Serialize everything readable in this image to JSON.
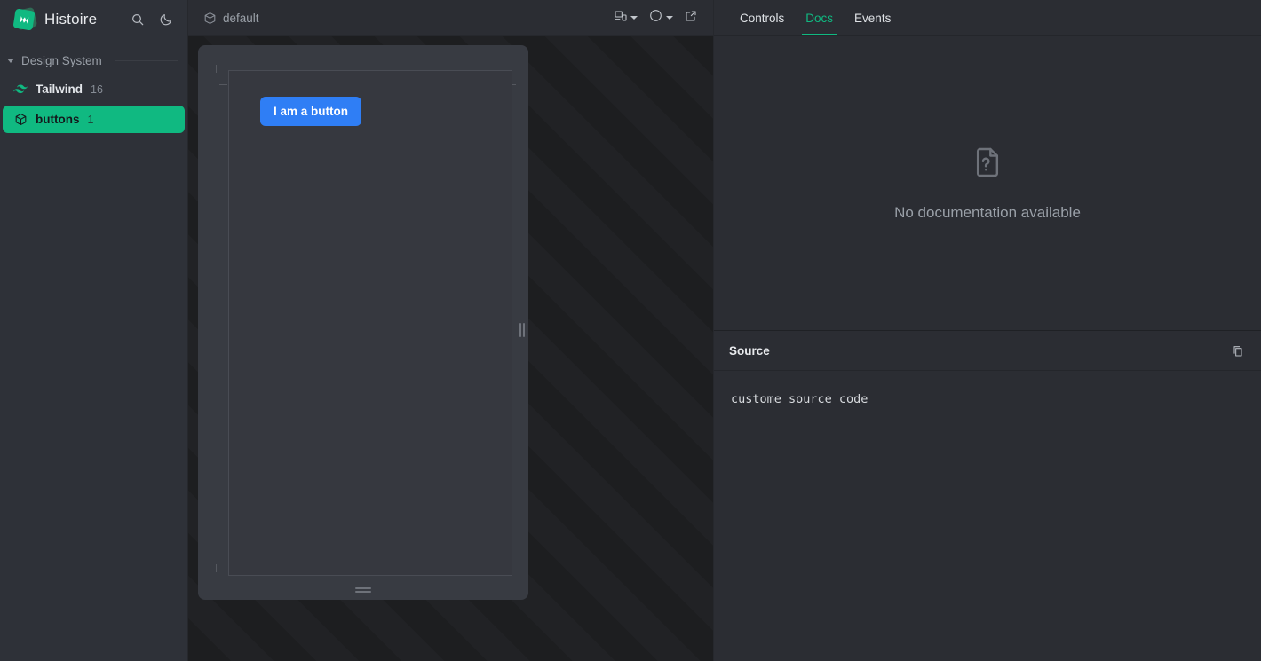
{
  "sidebar": {
    "brand": "Histoire",
    "search_icon": "search-icon",
    "theme_icon": "moon-icon",
    "group": {
      "label": "Design System",
      "collapse_icon": "triangle-down-icon"
    },
    "items": [
      {
        "label": "Tailwind",
        "count": "16",
        "icon": "tailwind-icon",
        "active": false
      },
      {
        "label": "buttons",
        "count": "1",
        "icon": "cube-icon",
        "active": true
      }
    ]
  },
  "center": {
    "story_title": "default",
    "story_icon": "cube-icon",
    "toolbar": [
      {
        "name": "responsive-size-button",
        "icon": "responsive-icon",
        "has_chevron": true
      },
      {
        "name": "background-color-button",
        "icon": "circle-icon",
        "has_chevron": true
      },
      {
        "name": "open-in-new-tab-button",
        "icon": "external-link-icon",
        "has_chevron": false
      }
    ],
    "preview": {
      "button_label": "I am a button",
      "button_color": "#2f7ef5",
      "resize_handle_v": "resize-handle-vertical",
      "resize_handle_h": "resize-handle-horizontal"
    }
  },
  "right": {
    "tabs": [
      {
        "label": "Controls",
        "active": false
      },
      {
        "label": "Docs",
        "active": true
      },
      {
        "label": "Events",
        "active": false
      }
    ],
    "docs": {
      "empty_icon": "file-question-icon",
      "empty_text": "No documentation available"
    },
    "source": {
      "title": "Source",
      "copy_icon": "copy-icon",
      "code": "custome source code"
    }
  },
  "colors": {
    "accent": "#10b981",
    "sidebar_bg": "#2e3138",
    "panel_bg": "#2b2d33",
    "stage_bg": "#1d1e20",
    "preview_bg": "#383b42",
    "button_blue": "#2f7ef5"
  }
}
